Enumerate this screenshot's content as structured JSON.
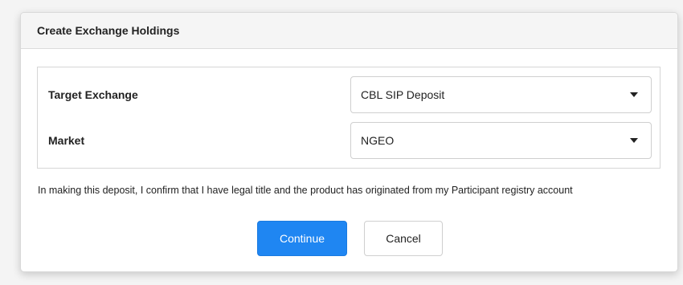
{
  "dialog": {
    "title": "Create Exchange Holdings"
  },
  "form": {
    "target_exchange": {
      "label": "Target Exchange",
      "selected": "CBL SIP Deposit"
    },
    "market": {
      "label": "Market",
      "selected": "NGEO"
    }
  },
  "confirmation_text": "In making this deposit, I confirm that I have legal title and the product has originated from my Participant registry account",
  "buttons": {
    "continue_label": "Continue",
    "cancel_label": "Cancel"
  },
  "colors": {
    "primary": "#1f86f2",
    "header_bg": "#f5f5f5"
  }
}
